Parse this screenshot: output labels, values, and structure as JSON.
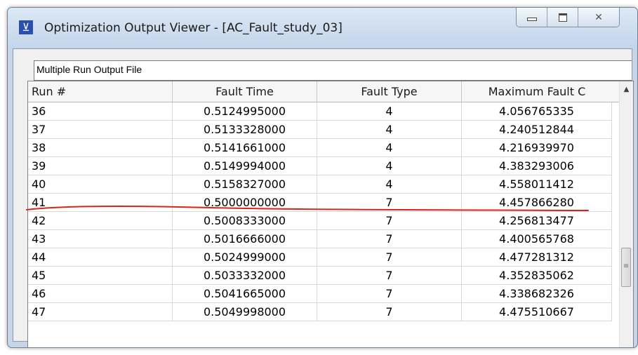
{
  "window": {
    "title": "Optimization Output Viewer - [AC_Fault_study_03]",
    "controls": {
      "minimize": "minimize",
      "maximize": "maximize",
      "close": "✕"
    }
  },
  "file_box": {
    "label": "Multiple Run Output File"
  },
  "table": {
    "columns": [
      "Run #",
      "Fault Time",
      "Fault Type",
      "Maximum Fault C"
    ],
    "rows": [
      [
        "36",
        "0.5124995000",
        "4",
        "4.056765335"
      ],
      [
        "37",
        "0.5133328000",
        "4",
        "4.240512844"
      ],
      [
        "38",
        "0.5141661000",
        "4",
        "4.216939970"
      ],
      [
        "39",
        "0.5149994000",
        "4",
        "4.383293006"
      ],
      [
        "40",
        "0.5158327000",
        "4",
        "4.558011412"
      ],
      [
        "41",
        "0.5000000000",
        "7",
        "4.457866280"
      ],
      [
        "42",
        "0.5008333000",
        "7",
        "4.256813477"
      ],
      [
        "43",
        "0.5016666000",
        "7",
        "4.400565768"
      ],
      [
        "44",
        "0.5024999000",
        "7",
        "4.477281312"
      ],
      [
        "45",
        "0.5033332000",
        "7",
        "4.352835062"
      ],
      [
        "46",
        "0.5041665000",
        "7",
        "4.338682326"
      ],
      [
        "47",
        "0.5049998000",
        "7",
        "4.475510667"
      ]
    ]
  },
  "scrollbar": {
    "up_icon": "▲",
    "down_icon": "▼",
    "grip_icon": "≡"
  },
  "colors": {
    "annotation_line": "#e0201b",
    "app_icon": "#2b4fae"
  }
}
